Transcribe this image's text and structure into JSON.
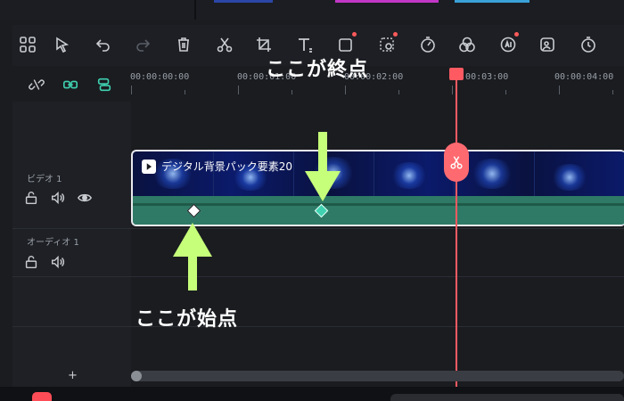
{
  "colors": {
    "accent_teal": "#3fd1b0",
    "playhead": "#ff5a62",
    "arrow_green": "#c6ff7a",
    "audio_bar": "#2f7a66"
  },
  "toolbar": {
    "icons": [
      "multi-select-icon",
      "select-arrow-icon",
      "undo-icon",
      "redo-icon",
      "delete-icon",
      "cut-icon",
      "crop-icon",
      "text-icon",
      "shape-icon",
      "mask-icon",
      "speed-icon",
      "color-icon",
      "ai-icon",
      "sticker-icon",
      "timer-icon"
    ]
  },
  "ruler": {
    "ticks": [
      "00:00:00:00",
      "00:00:01:00",
      "00:00:02:00",
      "00:00:03:00",
      "00:00:04:00"
    ]
  },
  "tracks": {
    "video_label": "ビデオ 1",
    "audio_label": "オーディオ 1",
    "add_label": "+"
  },
  "clip": {
    "title": "デジタル背景パック要素20"
  },
  "keyframes": {
    "start_color": "#ffffff",
    "end_color": "#3fd1b0"
  },
  "annotations": {
    "end_point": "ここが終点",
    "start_point": "ここが始点"
  }
}
